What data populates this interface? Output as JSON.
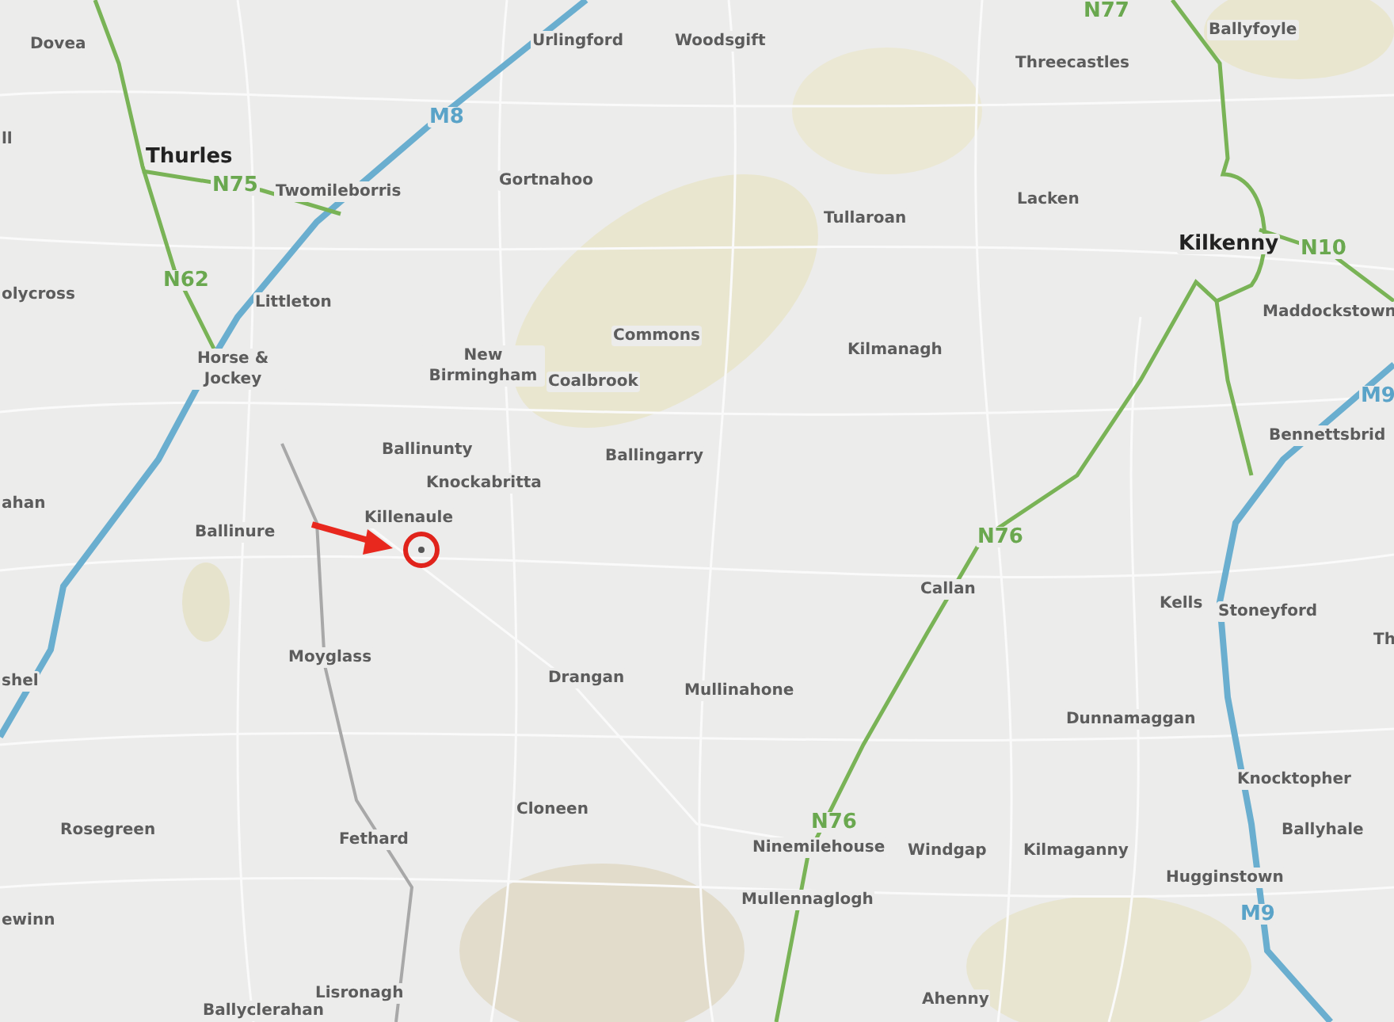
{
  "map": {
    "labels": [
      {
        "text": "Dovea",
        "kind": "place"
      },
      {
        "text": "Urlingford",
        "kind": "place"
      },
      {
        "text": "Woodsgift",
        "kind": "place"
      },
      {
        "text": "N77",
        "kind": "national_road"
      },
      {
        "text": "Ballyfoyle",
        "kind": "place"
      },
      {
        "text": "Threecastles",
        "kind": "place"
      },
      {
        "text": "M8",
        "kind": "motorway"
      },
      {
        "text": "ll",
        "kind": "place"
      },
      {
        "text": "Thurles",
        "kind": "major_place"
      },
      {
        "text": "N75",
        "kind": "national_road"
      },
      {
        "text": "Twomileborris",
        "kind": "place"
      },
      {
        "text": "Gortnahoo",
        "kind": "place"
      },
      {
        "text": "Lacken",
        "kind": "place"
      },
      {
        "text": "Tullaroan",
        "kind": "place"
      },
      {
        "text": "Kilkenny",
        "kind": "major_place"
      },
      {
        "text": "N10",
        "kind": "national_road"
      },
      {
        "text": "N62",
        "kind": "national_road"
      },
      {
        "text": "olycross",
        "kind": "place"
      },
      {
        "text": "Littleton",
        "kind": "place"
      },
      {
        "text": "Horse & Jockey",
        "kind": "place"
      },
      {
        "text": "New Birmingham",
        "kind": "place"
      },
      {
        "text": "Commons",
        "kind": "place"
      },
      {
        "text": "Coalbrook",
        "kind": "place"
      },
      {
        "text": "Kilmanagh",
        "kind": "place"
      },
      {
        "text": "Maddockstown",
        "kind": "place"
      },
      {
        "text": "M9",
        "kind": "motorway"
      },
      {
        "text": "Bennettsbrid",
        "kind": "place"
      },
      {
        "text": "Ballinunty",
        "kind": "place"
      },
      {
        "text": "Ballingarry",
        "kind": "place"
      },
      {
        "text": "Knockabritta",
        "kind": "place"
      },
      {
        "text": "ahan",
        "kind": "place"
      },
      {
        "text": "Killenaule",
        "kind": "place"
      },
      {
        "text": "Ballinure",
        "kind": "place"
      },
      {
        "text": "N76",
        "kind": "national_road"
      },
      {
        "text": "Callan",
        "kind": "place"
      },
      {
        "text": "Kells",
        "kind": "place"
      },
      {
        "text": "Stoneyford",
        "kind": "place"
      },
      {
        "text": "Th",
        "kind": "place"
      },
      {
        "text": "Moyglass",
        "kind": "place"
      },
      {
        "text": "Drangan",
        "kind": "place"
      },
      {
        "text": "shel",
        "kind": "place"
      },
      {
        "text": "Mullinahone",
        "kind": "place"
      },
      {
        "text": "Dunnamaggan",
        "kind": "place"
      },
      {
        "text": "Knocktopher",
        "kind": "place"
      },
      {
        "text": "Cloneen",
        "kind": "place"
      },
      {
        "text": "N76",
        "kind": "national_road"
      },
      {
        "text": "Rosegreen",
        "kind": "place"
      },
      {
        "text": "Ballyhale",
        "kind": "place"
      },
      {
        "text": "Fethard",
        "kind": "place"
      },
      {
        "text": "Ninemilehouse",
        "kind": "place"
      },
      {
        "text": "Windgap",
        "kind": "place"
      },
      {
        "text": "Kilmaganny",
        "kind": "place"
      },
      {
        "text": "Hugginstown",
        "kind": "place"
      },
      {
        "text": "Mullennaglogh",
        "kind": "place"
      },
      {
        "text": "ewinn",
        "kind": "place"
      },
      {
        "text": "M9",
        "kind": "motorway"
      },
      {
        "text": "Lisronagh",
        "kind": "place"
      },
      {
        "text": "Ahenny",
        "kind": "place"
      },
      {
        "text": "Ballyclerahan",
        "kind": "place"
      }
    ]
  }
}
